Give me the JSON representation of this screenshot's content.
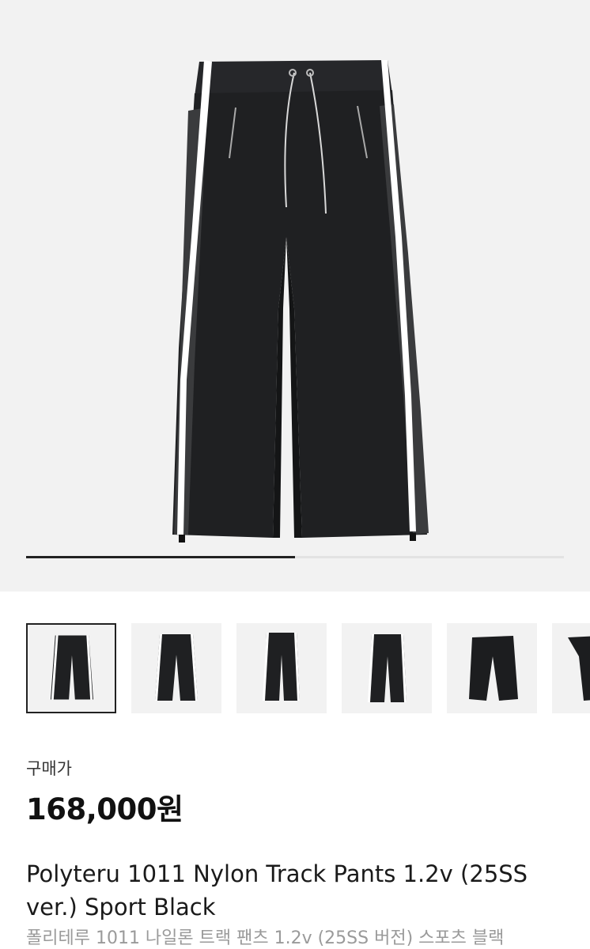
{
  "gallery": {
    "progress_fraction": 0.5,
    "main_image_alt": "Black nylon track pants with white side stripes",
    "thumbnail_count_visible": 6,
    "selected_thumbnail_index": 0
  },
  "purchase": {
    "price_label": "구매가",
    "price": "168,000원"
  },
  "product": {
    "title": "Polyteru 1011 Nylon Track Pants 1.2v (25SS ver.) Sport Black",
    "subtitle": "폴리테루 1011 나일론 트랙 팬츠 1.2v (25SS 버전) 스포츠 블랙"
  },
  "colors": {
    "hero_bg": "#f2f2f2",
    "pants": "#1f2022",
    "stripe": "#ffffff",
    "panel": "#3a3b3d"
  }
}
